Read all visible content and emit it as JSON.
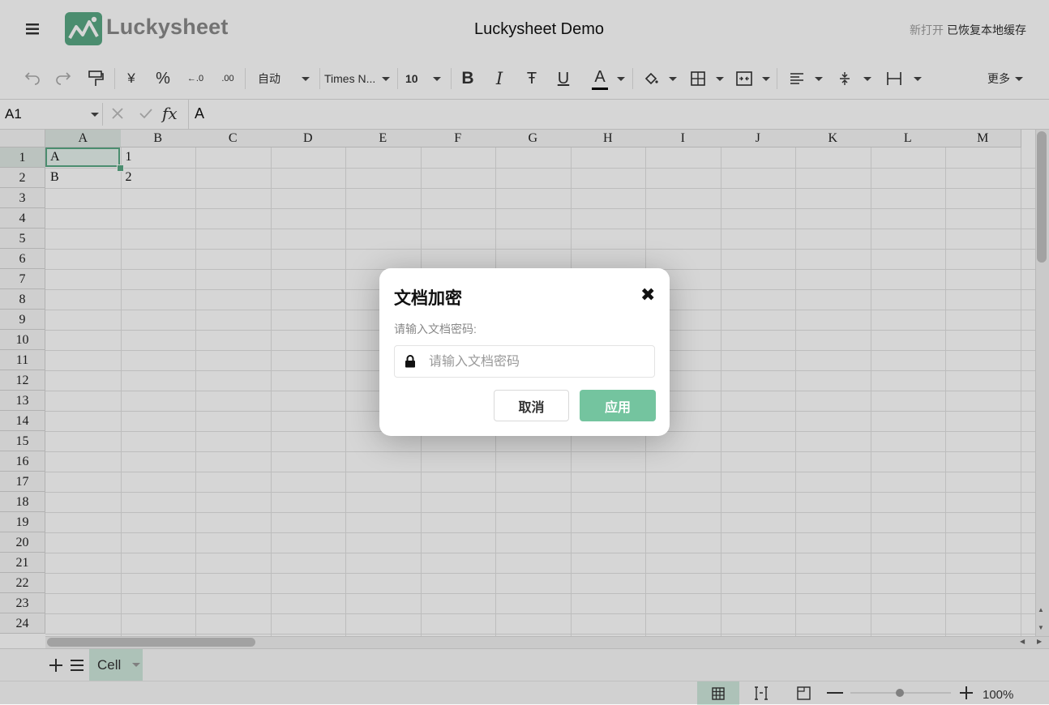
{
  "app": {
    "title": "Luckysheet Demo",
    "logo_text": "Luckysheet",
    "status_dim": "新打开",
    "status_text": "已恢复本地缓存"
  },
  "toolbar": {
    "currency_label": "¥",
    "percent_label": "%",
    "dec_decrease_label": "←.0",
    "dec_increase_label": ".00",
    "format_label": "自动",
    "font_label": "Times N...",
    "size_label": "10",
    "bold_label": "B",
    "italic_label": "I",
    "strike_label": "Ŧ",
    "underline_label": "U",
    "text_color_label": "A",
    "more_label": "更多"
  },
  "formula_bar": {
    "cell_ref": "A1",
    "fx_label": "fx",
    "value": "A"
  },
  "grid": {
    "columns": [
      "A",
      "B",
      "C",
      "D",
      "E",
      "F",
      "G",
      "H",
      "I",
      "J",
      "K",
      "L",
      "M"
    ],
    "rows": [
      "1",
      "2",
      "3",
      "4",
      "5",
      "6",
      "7",
      "8",
      "9",
      "10",
      "11",
      "12",
      "13",
      "14",
      "15",
      "16",
      "17",
      "18",
      "19",
      "20",
      "21",
      "22",
      "23",
      "24"
    ],
    "cells": [
      {
        "ref": "A1",
        "value": "A"
      },
      {
        "ref": "B1",
        "value": "1"
      },
      {
        "ref": "A2",
        "value": "B"
      },
      {
        "ref": "B2",
        "value": "2"
      }
    ]
  },
  "sheets": {
    "tab_label": "Cell"
  },
  "status": {
    "zoom": "100%"
  },
  "dialog": {
    "title": "文档加密",
    "close_label": "✖",
    "prompt": "请输入文档密码:",
    "input_placeholder": "请输入文档密码",
    "cancel_label": "取消",
    "apply_label": "应用"
  },
  "colors": {
    "accent": "#74c49f",
    "logo": "#5aa985",
    "sheet_tab": "#cfe7dc"
  }
}
